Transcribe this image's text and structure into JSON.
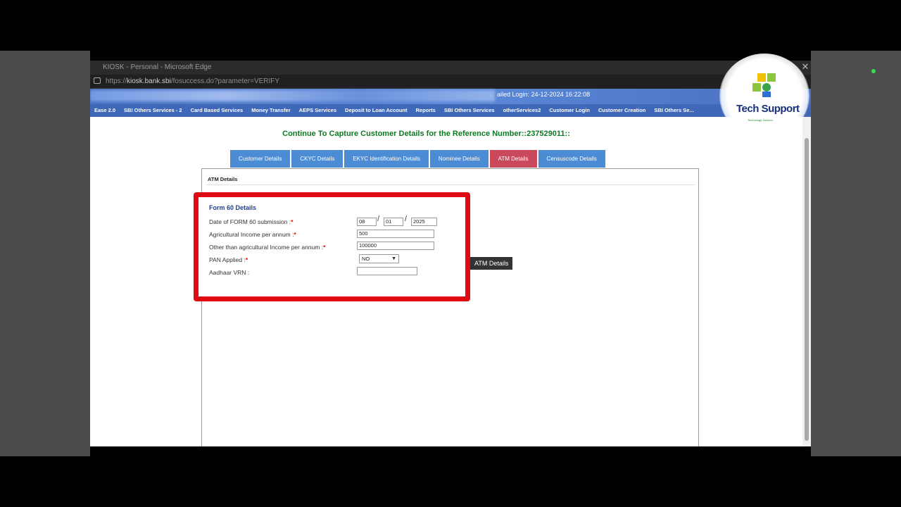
{
  "browser": {
    "title": "KIOSK - Personal - Microsoft Edge",
    "url_prefix": "https://",
    "url_host": "kiosk.bank.sbi",
    "url_path": "/fosuccess.do?parameter=VERIFY",
    "close": "✕"
  },
  "header": {
    "last_login": "ailed Login: 24-12-2024 16:22:08"
  },
  "nav": [
    "Ease 2.0",
    "SBI Others Services - 2",
    "Card Based Services",
    "Money Transfer",
    "AEPS Services",
    "Deposit to Loan Account",
    "Reports",
    "SBI Others Services",
    "otherServices2",
    "Customer Login",
    "Customer Creation",
    "SBI Others Se..."
  ],
  "page": {
    "heading": "Continue To Capture Customer Details for the Reference Number::237529011::"
  },
  "tabs": [
    {
      "label": "Customer Details",
      "active": false
    },
    {
      "label": "CKYC Details",
      "active": false
    },
    {
      "label": "EKYC Identification Details",
      "active": false
    },
    {
      "label": "Nominee Details",
      "active": false
    },
    {
      "label": "ATM Details",
      "active": true
    },
    {
      "label": "Censuscode Details",
      "active": false
    }
  ],
  "panel": {
    "title": "ATM Details"
  },
  "form60": {
    "title": "Form 60 Details",
    "date_label": "Date of FORM 60 submission :",
    "date_dd": "08",
    "date_mm": "01",
    "date_yyyy": "2025",
    "agri_label": "Agricultural Income per annum  :",
    "agri_value": "500",
    "other_label": "Other than agricultural Income per annum  :",
    "other_value": "100000",
    "pan_label": "PAN Applied  :",
    "pan_value": "NO",
    "aadhaar_label": "Aadhaar VRN   :",
    "aadhaar_value": "",
    "required_mark": "*",
    "slash": "/"
  },
  "tooltip": "ATM Details",
  "logo": {
    "brand": "Tech Support",
    "tagline": "Technology Solution"
  },
  "colors": {
    "heading": "#0c7a22",
    "tab": "#4c8cd4",
    "tab_active": "#c9485b",
    "highlight": "#e00b12"
  }
}
